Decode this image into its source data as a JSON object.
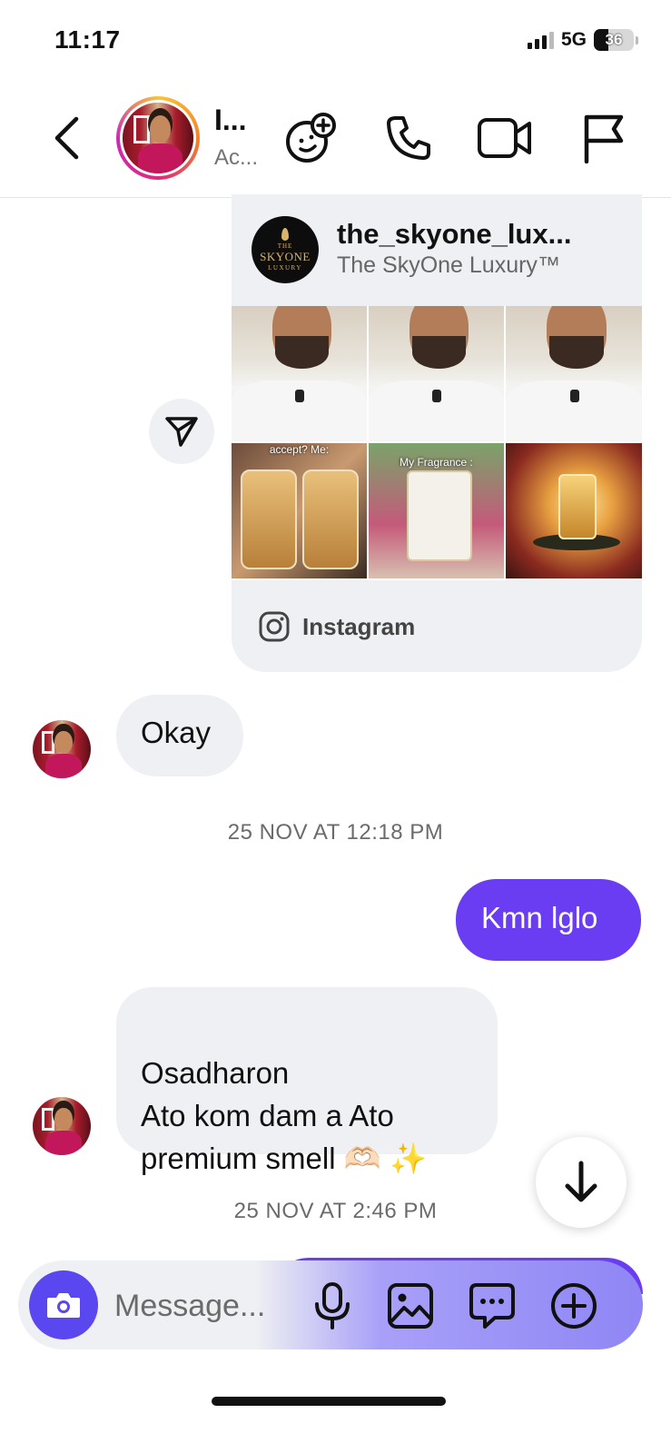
{
  "status_bar": {
    "time": "11:17",
    "network": "5G",
    "battery": "36"
  },
  "header": {
    "name": "I...",
    "status": "Ac..."
  },
  "shared_post": {
    "account_handle": "the_skyone_lux...",
    "account_name": "The SkyOne Luxury™",
    "logo_lines": [
      "THE",
      "SKYONE",
      "LUXURY"
    ],
    "grid_captions": [
      "",
      "",
      "",
      "accept? Me:",
      "My Fragrance :",
      ""
    ],
    "source_label": "Instagram"
  },
  "messages": [
    {
      "direction": "in",
      "text": "Okay"
    },
    {
      "direction": "out",
      "text": "Kmn lglo"
    },
    {
      "direction": "in",
      "text": "Osadharon\nAto kom dam a Ato\npremium smell 🫶🏻 ✨"
    }
  ],
  "timestamps": {
    "first": "25 NOV AT 12:18 PM",
    "second": "25 NOV AT 2:46 PM"
  },
  "composer": {
    "placeholder": "Message..."
  },
  "colors": {
    "accent": "#6a3df3",
    "camera_button": "#5b47f0",
    "incoming_bubble": "#eef0f3"
  }
}
